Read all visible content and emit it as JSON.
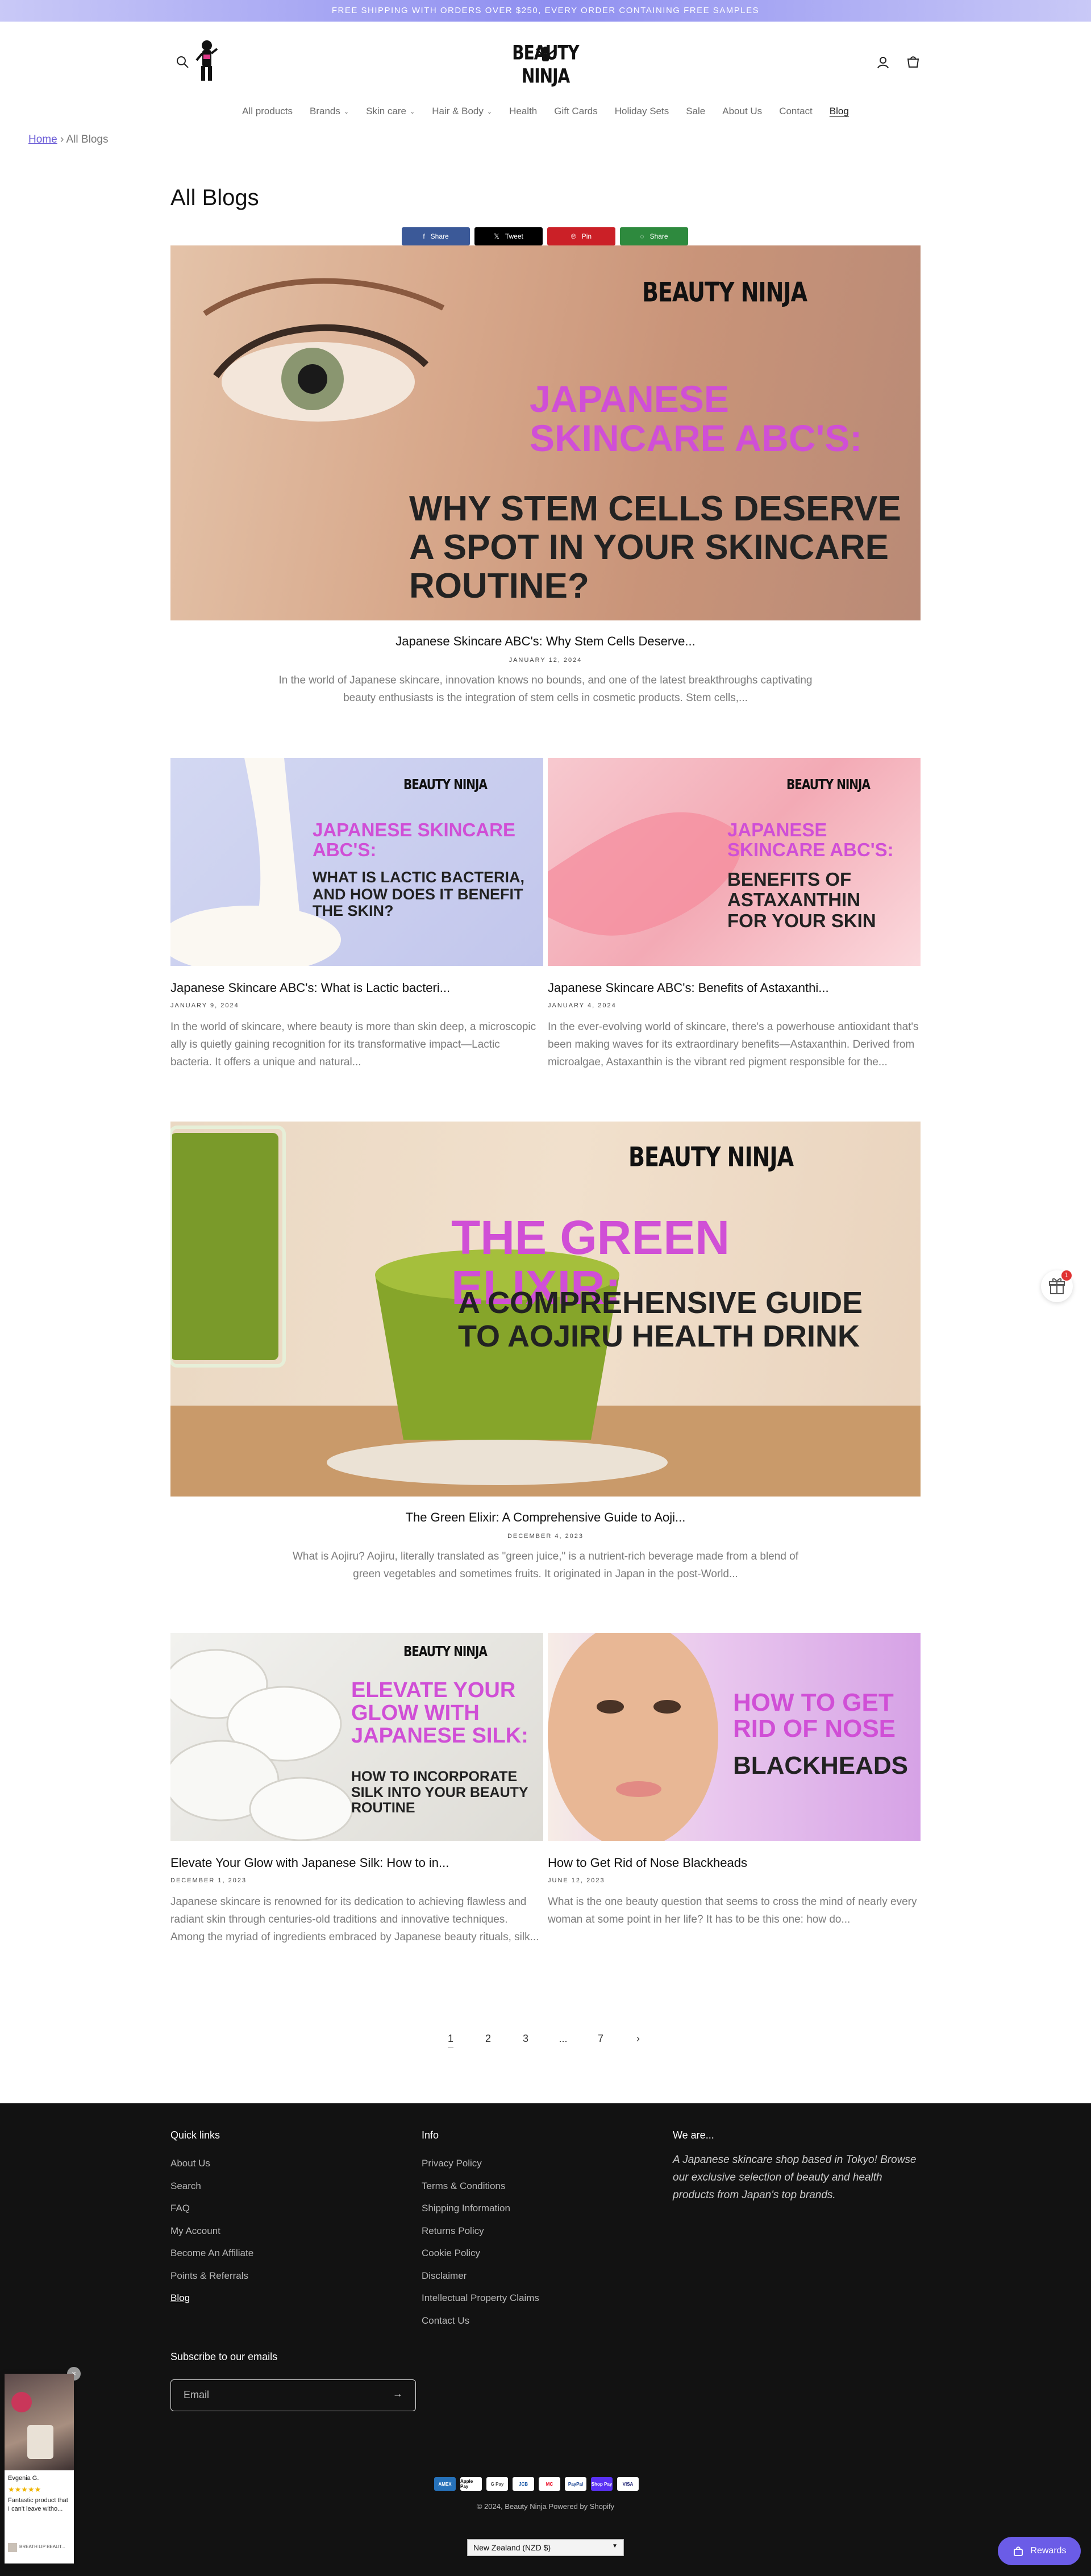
{
  "announcement": "FREE SHIPPING WITH ORDERS OVER $250, EVERY ORDER CONTAINING FREE SAMPLES",
  "logo_text": "BEAUTY NINJA",
  "nav": [
    {
      "label": "All products",
      "dropdown": false
    },
    {
      "label": "Brands",
      "dropdown": true
    },
    {
      "label": "Skin care",
      "dropdown": true
    },
    {
      "label": "Hair & Body",
      "dropdown": true
    },
    {
      "label": "Health",
      "dropdown": false
    },
    {
      "label": "Gift Cards",
      "dropdown": false
    },
    {
      "label": "Holiday Sets",
      "dropdown": false
    },
    {
      "label": "Sale",
      "dropdown": false
    },
    {
      "label": "About Us",
      "dropdown": false
    },
    {
      "label": "Contact",
      "dropdown": false
    },
    {
      "label": "Blog",
      "dropdown": false,
      "active": true
    }
  ],
  "breadcrumb": {
    "home": "Home",
    "separator": "›",
    "current": "All Blogs"
  },
  "page_title": "All Blogs",
  "share": {
    "facebook": "Share",
    "twitter": "Tweet",
    "pinterest": "Pin",
    "whatsapp": "Share"
  },
  "articles": [
    {
      "title": "Japanese Skincare ABC's: Why Stem Cells Deserve...",
      "date": "JANUARY 12, 2024",
      "excerpt": "In the world of Japanese skincare, innovation knows no bounds, and one of the latest breakthroughs captivating beauty enthusiasts is the integration of stem cells in cosmetic products. Stem cells,...",
      "image": {
        "headline": "JAPANESE SKINCARE ABC'S:",
        "subline": "WHY STEM CELLS DESERVE A SPOT IN YOUR SKINCARE ROUTINE?"
      }
    },
    {
      "title": "Japanese Skincare ABC's: What is Lactic bacteri...",
      "date": "JANUARY 9, 2024",
      "excerpt": "In the world of skincare, where beauty is more than skin deep, a microscopic ally is quietly gaining recognition for its transformative impact—Lactic bacteria. It offers a unique and natural...",
      "image": {
        "headline": "JAPANESE SKINCARE ABC'S:",
        "subline": "WHAT IS LACTIC BACTERIA, AND HOW DOES IT BENEFIT THE SKIN?"
      }
    },
    {
      "title": "Japanese Skincare ABC's: Benefits of Astaxanthi...",
      "date": "JANUARY 4, 2024",
      "excerpt": "In the ever-evolving world of skincare, there's a powerhouse antioxidant that's been making waves for its extraordinary benefits—Astaxanthin. Derived from microalgae, Astaxanthin is the vibrant red pigment responsible for the...",
      "image": {
        "headline": "JAPANESE SKINCARE ABC'S:",
        "subline": "BENEFITS OF ASTAXANTHIN FOR YOUR SKIN"
      }
    },
    {
      "title": "The Green Elixir: A Comprehensive Guide to Aoji...",
      "date": "DECEMBER 4, 2023",
      "excerpt": "What is Aojiru? Aojiru, literally translated as \"green juice,\" is a nutrient-rich beverage made from a blend of green vegetables and sometimes fruits. It originated in Japan in the post-World...",
      "image": {
        "headline": "THE GREEN ELIXIR:",
        "subline": "A COMPREHENSIVE GUIDE TO AOJIRU HEALTH DRINK"
      }
    },
    {
      "title": "Elevate Your Glow with Japanese Silk: How to in...",
      "date": "DECEMBER 1, 2023",
      "excerpt": "Japanese skincare is renowned for its dedication to achieving flawless and radiant skin through centuries-old traditions and innovative techniques. Among the myriad of ingredients embraced by Japanese beauty rituals, silk...",
      "image": {
        "headline": "ELEVATE YOUR GLOW WITH JAPANESE SILK:",
        "subline": "HOW TO INCORPORATE SILK INTO YOUR BEAUTY ROUTINE"
      }
    },
    {
      "title": "How to Get Rid of Nose Blackheads",
      "date": "JUNE 12, 2023",
      "excerpt": "What is the one beauty question that seems to cross the mind of nearly every woman at some point in her life? It has to be this one: how do...",
      "image": {
        "headline": "HOW TO GET RID OF NOSE",
        "subline": "BLACKHEADS"
      }
    }
  ],
  "pagination": [
    "1",
    "2",
    "3",
    "...",
    "7",
    "›"
  ],
  "footer": {
    "quick_links_title": "Quick links",
    "quick_links": [
      "About Us",
      "Search",
      "FAQ",
      "My Account",
      "Become An Affiliate",
      "Points & Referrals",
      "Blog"
    ],
    "info_title": "Info",
    "info_links": [
      "Privacy Policy",
      "Terms & Conditions",
      "Shipping Information",
      "Returns Policy",
      "Cookie Policy",
      "Disclaimer",
      "Intellectual Property Claims",
      "Contact Us"
    ],
    "we_are_title": "We are...",
    "we_are_text": "A Japanese skincare shop based in Tokyo! Browse our exclusive selection of beauty and health products from Japan's top brands.",
    "subscribe_title": "Subscribe to our emails",
    "email_placeholder": "Email",
    "payments": [
      "AMEX",
      "Apple Pay",
      "G Pay",
      "JCB",
      "MC",
      "PayPal",
      "Shop Pay",
      "VISA"
    ],
    "copyright": "© 2024, Beauty Ninja Powered by Shopify",
    "country": "New Zealand (NZD $)"
  },
  "widgets": {
    "rewards_label": "Rewards",
    "gift_badge": "1",
    "review_name": "Evgenia G.",
    "review_text": "Fantastic product that I can't leave witho...",
    "review_product": "BREATH LIP BEAUT..."
  },
  "colors": {
    "accent": "#6b5ce7",
    "pink": "#d04fd6",
    "footer_bg": "#121212"
  }
}
